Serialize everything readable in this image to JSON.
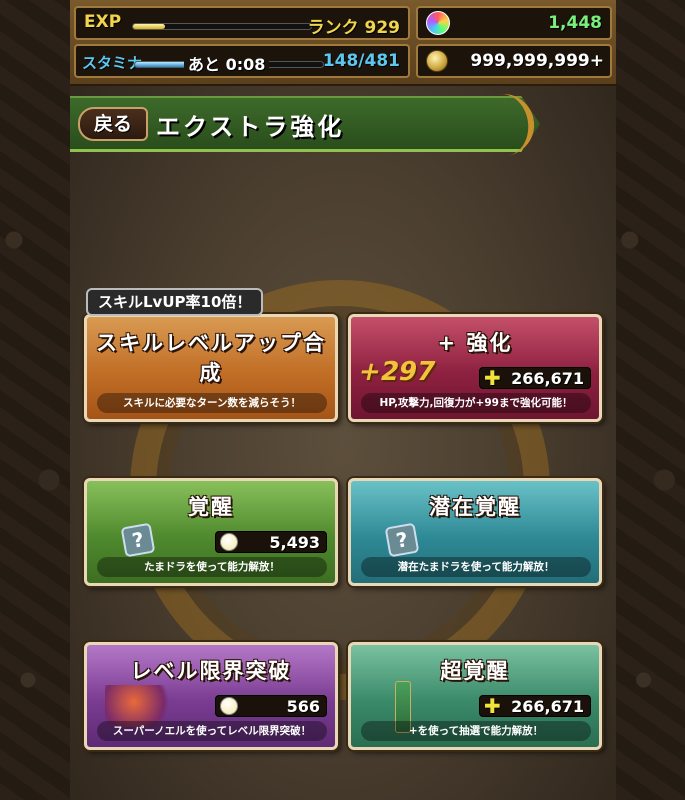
{
  "status": {
    "exp_label": "EXP",
    "exp_progress": 0.18,
    "rank": "ランク 929",
    "stamina_label": "スタミナ",
    "stamina_progress": 0.31,
    "stamina_remaining": "あと 0:08",
    "stamina_value": "148/481",
    "magic_stones": "1,448",
    "coins": "999,999,999+"
  },
  "header": {
    "back_label": "戻る",
    "title": "エクストラ強化"
  },
  "cards": {
    "skill": {
      "tag": "スキルLvUP率10倍！",
      "title": "スキルレベルアップ合成",
      "desc": "スキルに必要なターン数を減らそう！"
    },
    "plus": {
      "title": "+ 強化",
      "art": "+297",
      "cost": "266,671",
      "desc": "HP,攻撃力,回復力が+99まで強化可能！"
    },
    "awaken": {
      "title": "覚醒",
      "cost": "5,493",
      "desc": "たまドラを使って能力解放！"
    },
    "latent": {
      "title": "潜在覚醒",
      "desc": "潜在たまドラを使って能力解放！"
    },
    "limit": {
      "title": "レベル限界突破",
      "cost": "566",
      "desc": "スーパーノエルを使ってレベル限界突破！"
    },
    "super": {
      "title": "超覚醒",
      "cost": "266,671",
      "desc": "+を使って抽選で能力解放！"
    }
  },
  "colors": {
    "exp": "#f1d54c",
    "stamina": "#5cc8f2",
    "stones": "#7af07a"
  }
}
